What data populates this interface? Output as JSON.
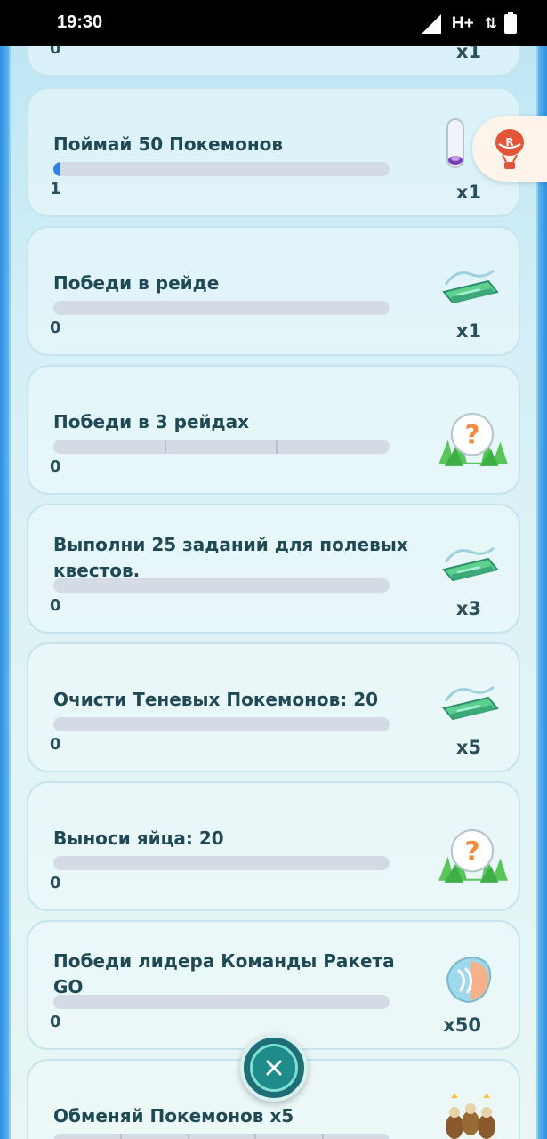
{
  "status_bar": {
    "time": "19:30",
    "network": "H+",
    "data_arrows": "⇅"
  },
  "quests": [
    {
      "title": "",
      "progress": 0,
      "count": "0",
      "reward_qty": "x1",
      "reward_icon": "incubator-icon"
    },
    {
      "title": "Поймай 50 Покемонов",
      "progress": 0.02,
      "count": "1",
      "reward_qty": "x1",
      "reward_icon": "incense-icon"
    },
    {
      "title": "Победи в рейде",
      "progress": 0,
      "count": "0",
      "reward_qty": "x1",
      "reward_icon": "raid-pass-icon"
    },
    {
      "title": "Победи в 3 рейдах",
      "progress": 0,
      "count": "0",
      "reward_qty": "",
      "reward_icon": "mystery-encounter-icon"
    },
    {
      "title": "Выполни 25 заданий для полевых квестов.",
      "progress": 0,
      "count": "0",
      "reward_qty": "x3",
      "reward_icon": "raid-pass-icon"
    },
    {
      "title": "Очисти Теневых Покемонов: 20",
      "progress": 0,
      "count": "0",
      "reward_qty": "x5",
      "reward_icon": "raid-pass-icon"
    },
    {
      "title": "Выноси яйца: 20",
      "progress": 0,
      "count": "0",
      "reward_qty": "",
      "reward_icon": "mystery-encounter-icon"
    },
    {
      "title": "Победи лидера Команды Ракета GO",
      "progress": 0,
      "count": "0",
      "reward_qty": "x50",
      "reward_icon": "rare-candy-icon"
    },
    {
      "title": "Обменяй Покемонов x5",
      "progress": 0,
      "count": "",
      "reward_qty": "",
      "reward_icon": "pokemon-group-icon"
    }
  ],
  "side_button": {
    "icon": "team-rocket-balloon-icon"
  },
  "close_button": {
    "icon": "close-icon"
  },
  "colors": {
    "accent": "#2f7fe6",
    "title_text": "#1f4a55",
    "fab": "#1e6e78"
  }
}
